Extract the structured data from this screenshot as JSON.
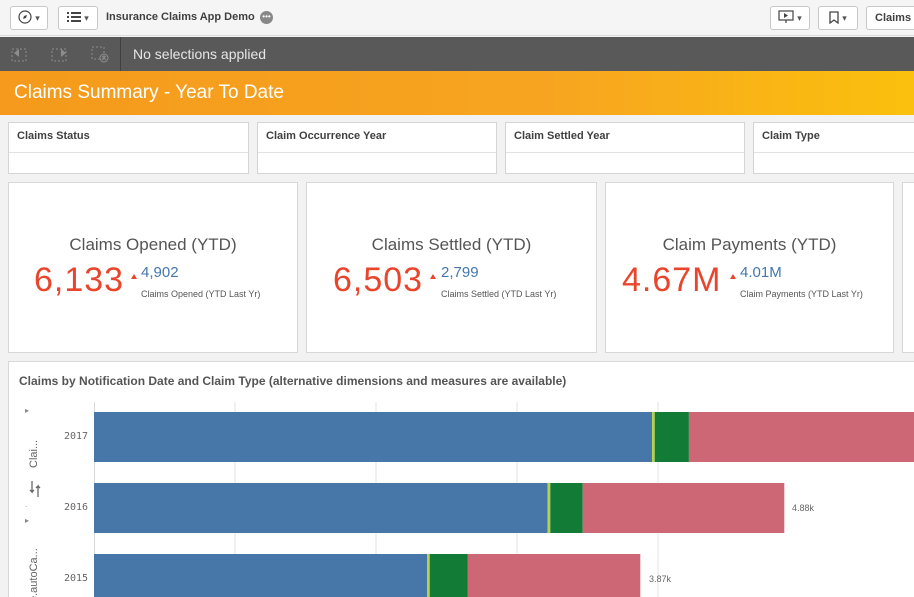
{
  "toolbar": {
    "app_title": "Insurance Claims App Demo",
    "sheet_button_label": "Claims"
  },
  "selections": {
    "status_text": "No selections applied"
  },
  "header": {
    "title": "Claims Summary - Year To Date"
  },
  "filters": [
    {
      "label": "Claims Status"
    },
    {
      "label": "Claim Occurrence Year"
    },
    {
      "label": "Claim Settled Year"
    },
    {
      "label": "Claim Type"
    }
  ],
  "kpis": [
    {
      "title": "Claims Opened (YTD)",
      "value": "6,133",
      "previous": "4,902",
      "previous_label": "Claims Opened (YTD Last Yr)"
    },
    {
      "title": "Claims Settled (YTD)",
      "value": "6,503",
      "previous": "2,799",
      "previous_label": "Claims Settled (YTD Last Yr)"
    },
    {
      "title": "Claim Payments (YTD)",
      "value": "4.67M",
      "previous": "4.01M",
      "previous_label": "Claim Payments (YTD Last Yr)"
    }
  ],
  "chart": {
    "title": "Claims by Notification Date and Claim Type (alternative dimensions and measures are available)",
    "dimension_label_1": "Clai...",
    "dimension_label_2": "e.autoCa...",
    "separator": "."
  },
  "chart_data": {
    "type": "bar",
    "orientation": "horizontal",
    "stacked": true,
    "categories": [
      "2017",
      "2016",
      "2015"
    ],
    "series": [
      {
        "values": [
          3.1,
          2.52,
          1.85
        ]
      },
      {
        "values": [
          0.015,
          0.015,
          0.015
        ]
      },
      {
        "values": [
          0.19,
          0.18,
          0.21
        ]
      },
      {
        "values": [
          1.5,
          1.12,
          0.96
        ]
      }
    ],
    "totals_labels": [
      "",
      "4.88k",
      "3.87k"
    ],
    "colors": [
      "#4777a9",
      "#b9cf4e",
      "#127b36",
      "#cd6675"
    ],
    "grid": true
  }
}
